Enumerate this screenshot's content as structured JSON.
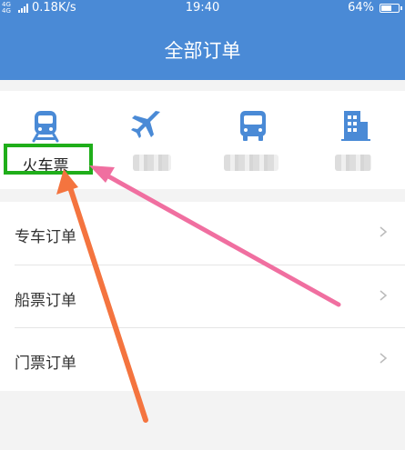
{
  "status_bar": {
    "network": "4G 4G",
    "speed": "0.18K/s",
    "time": "19:40",
    "battery_level": 0.64,
    "battery": "64%"
  },
  "header": {
    "title": "全部订单"
  },
  "categories": [
    {
      "label": "火车票",
      "icon": "train-icon"
    },
    {
      "label": "",
      "icon": "airplane-icon"
    },
    {
      "label": "",
      "icon": "bus-icon"
    },
    {
      "label": "",
      "icon": "hotel-icon"
    }
  ],
  "orders": [
    {
      "label": "专车订单",
      "icon": "chevron-right-icon"
    },
    {
      "label": "船票订单",
      "icon": "chevron-right-icon"
    },
    {
      "label": "门票订单",
      "icon": "chevron-right-icon"
    }
  ],
  "colors": {
    "header": "#4a8ad6",
    "icon": "#4a8ad6",
    "highlight": "#1fae1a",
    "arrow_pink": "#f06fa0",
    "arrow_orange": "#f4743f"
  }
}
